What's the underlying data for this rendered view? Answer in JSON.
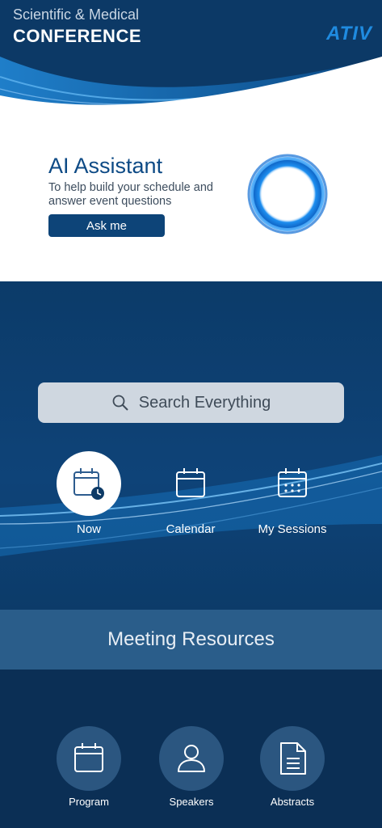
{
  "header": {
    "subtitle": "Scientific & Medical",
    "title": "CONFERENCE",
    "logo": "ATIV"
  },
  "assistant": {
    "title": "AI Assistant",
    "description": "To help build your schedule and answer event questions",
    "button_label": "Ask me"
  },
  "search": {
    "placeholder": "Search Everything",
    "icon": "search-icon"
  },
  "quick_actions": [
    {
      "label": "Now",
      "icon": "calendar-clock-icon",
      "active": true
    },
    {
      "label": "Calendar",
      "icon": "calendar-icon",
      "active": false
    },
    {
      "label": "My Sessions",
      "icon": "calendar-dots-icon",
      "active": false
    }
  ],
  "resources": {
    "title": "Meeting Resources",
    "items": [
      {
        "label": "Program",
        "icon": "calendar-icon"
      },
      {
        "label": "Speakers",
        "icon": "person-icon"
      },
      {
        "label": "Abstracts",
        "icon": "document-icon"
      }
    ]
  },
  "colors": {
    "primary": "#0c3966",
    "accent": "#1f8be0",
    "button": "#0d4478",
    "search_bg": "#cfd7e0",
    "resources_bar": "#2a5d8a"
  }
}
